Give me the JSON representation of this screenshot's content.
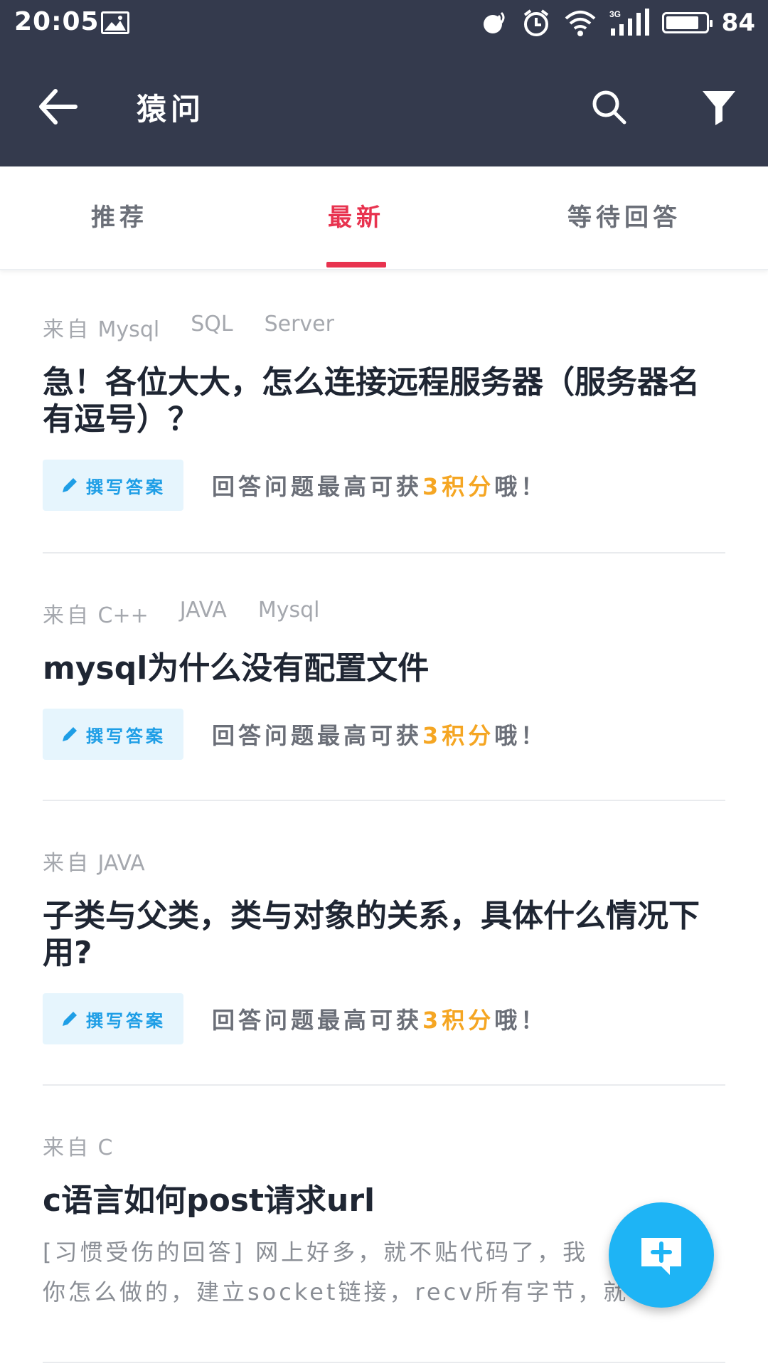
{
  "status_bar": {
    "time": "20:05",
    "battery_level": "84",
    "battery_fraction": 0.84
  },
  "app_bar": {
    "title": "猿问"
  },
  "tabs": [
    {
      "label": "推荐",
      "active": false
    },
    {
      "label": "最新",
      "active": true
    },
    {
      "label": "等待回答",
      "active": false
    }
  ],
  "questions": [
    {
      "from_label": "来自",
      "tags": [
        "Mysql",
        "SQL",
        "Server"
      ],
      "title_lines": [
        "急！各位大大，怎么连接远程服务器（服务器名",
        "有逗号）？"
      ],
      "write_answer_label": "撰写答案",
      "reward_prefix": "回答问题最高可获",
      "reward_points": "3积分",
      "reward_suffix": "哦！"
    },
    {
      "from_label": "来自",
      "tags": [
        "C++",
        "JAVA",
        "Mysql"
      ],
      "title_lines": [
        "mysql为什么没有配置文件"
      ],
      "write_answer_label": "撰写答案",
      "reward_prefix": "回答问题最高可获",
      "reward_points": "3积分",
      "reward_suffix": "哦！"
    },
    {
      "from_label": "来自",
      "tags": [
        "JAVA"
      ],
      "title_lines": [
        "子类与父类，类与对象的关系，具体什么情况下",
        "用?"
      ],
      "write_answer_label": "撰写答案",
      "reward_prefix": "回答问题最高可获",
      "reward_points": "3积分",
      "reward_suffix": "哦！"
    },
    {
      "from_label": "来自",
      "tags": [
        "C"
      ],
      "title_lines": [
        "c语言如何post请求url"
      ],
      "excerpt_lines": [
        "[习惯受伤的回答] 网上好多，就不贴代码了，我",
        "你怎么做的，建立socket链接，recv所有字节，就"
      ]
    }
  ],
  "colors": {
    "header_bg": "#343a4d",
    "active_tab": "#e8334f",
    "accent_blue": "#1eb4f5",
    "reward_orange": "#f5a623"
  },
  "icons": [
    "back-arrow-icon",
    "search-icon",
    "filter-icon",
    "pencil-icon",
    "add-comment-icon"
  ]
}
